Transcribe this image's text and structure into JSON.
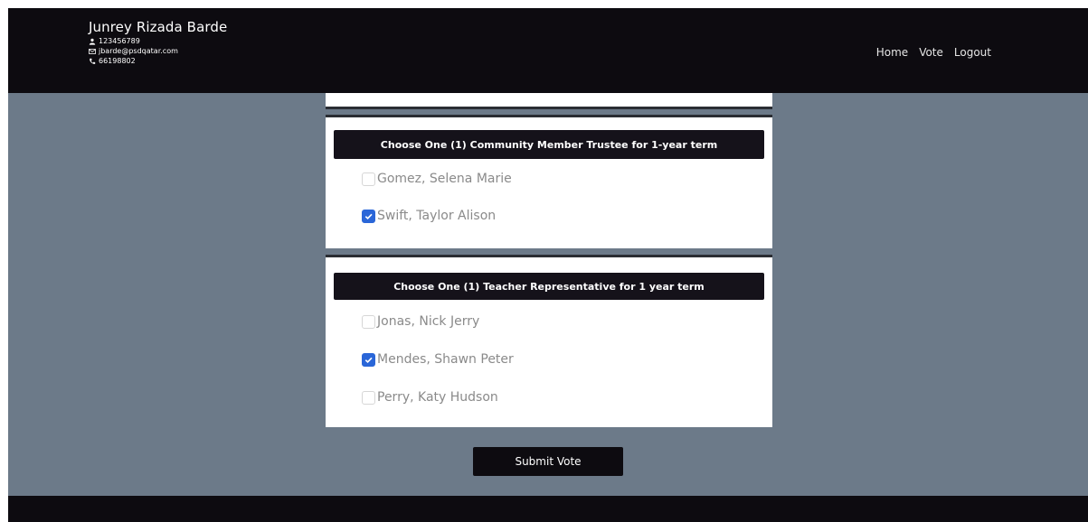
{
  "header": {
    "user_name": "Junrey Rizada Barde",
    "user_id": "123456789",
    "email": "jbarde@psdqatar.com",
    "phone": "66198802",
    "icons": [
      "user-icon",
      "mail-icon",
      "phone-icon"
    ]
  },
  "nav": {
    "home": "Home",
    "vote": "Vote",
    "logout": "Logout"
  },
  "ballots": [
    {
      "title": "Choose One (1) Community Member Trustee for 1-year term",
      "options": [
        {
          "label": "Gomez, Selena Marie",
          "checked": false
        },
        {
          "label": "Swift, Taylor Alison",
          "checked": true
        }
      ]
    },
    {
      "title": "Choose One (1) Teacher Representative for 1 year term",
      "options": [
        {
          "label": "Jonas, Nick Jerry",
          "checked": false
        },
        {
          "label": "Mendes, Shawn Peter",
          "checked": true
        },
        {
          "label": "Perry, Katy Hudson",
          "checked": false
        }
      ]
    }
  ],
  "submit_label": "Submit Vote",
  "colors": {
    "header": "#0d0b10",
    "background": "#6c7a89",
    "checkbox_checked": "#2a66d8"
  }
}
